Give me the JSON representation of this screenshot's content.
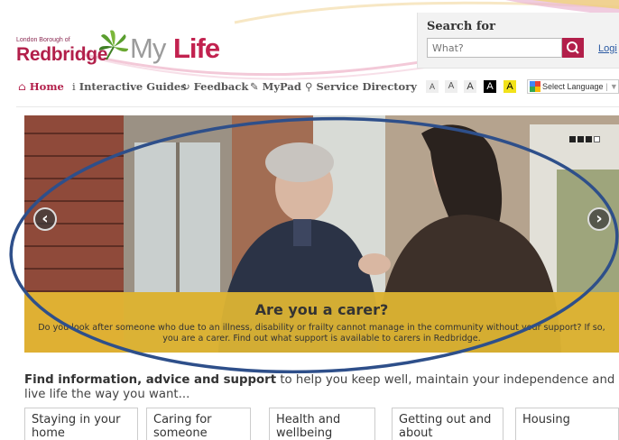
{
  "header": {
    "logo": {
      "small_text": "London Borough of",
      "borough": "Redbridge",
      "brand_my": "My",
      "brand_life": "Life"
    },
    "search": {
      "label": "Search for",
      "placeholder": "What?",
      "login": "Logi"
    }
  },
  "nav": {
    "items": [
      {
        "icon": "home-icon",
        "glyph": "⌂",
        "label": "Home"
      },
      {
        "icon": "info-icon",
        "glyph": "i",
        "label": "Interactive Guides"
      },
      {
        "icon": "refresh-icon",
        "glyph": "↻",
        "label": "Feedback"
      },
      {
        "icon": "edit-icon",
        "glyph": "✎",
        "label": "MyPad"
      },
      {
        "icon": "location-pin-icon",
        "glyph": "⚲",
        "label": "Service Directory"
      }
    ],
    "text_sizes": [
      "A",
      "A",
      "A",
      "A",
      "A"
    ],
    "language": "Select Language"
  },
  "hero": {
    "title": "Are you a carer?",
    "text": "Do you look after someone who due to an illness, disability or frailty cannot manage in the community without your support? If so, you are a carer. Find out what support is available to carers in Redbridge.",
    "prev_glyph": "‹",
    "next_glyph": "›",
    "slides_count": 4,
    "active_slide": 4,
    "annotation_color": "#2e4f8a"
  },
  "intro": {
    "bold": "Find information, advice and support",
    "rest": " to help you keep well, maintain your independence and live life the way you want..."
  },
  "categories": [
    {
      "label_1": "Staying in your",
      "label_2": "home"
    },
    {
      "label_1": "Caring for",
      "label_2": "someone"
    },
    {
      "label_1": "Health and",
      "label_2": "wellbeing"
    },
    {
      "label_1": "Getting out and",
      "label_2": "about"
    },
    {
      "label_1": "Housing",
      "label_2": ""
    }
  ],
  "colors": {
    "brand": "#b21f4a",
    "caption_bg": "#ebbe32"
  }
}
